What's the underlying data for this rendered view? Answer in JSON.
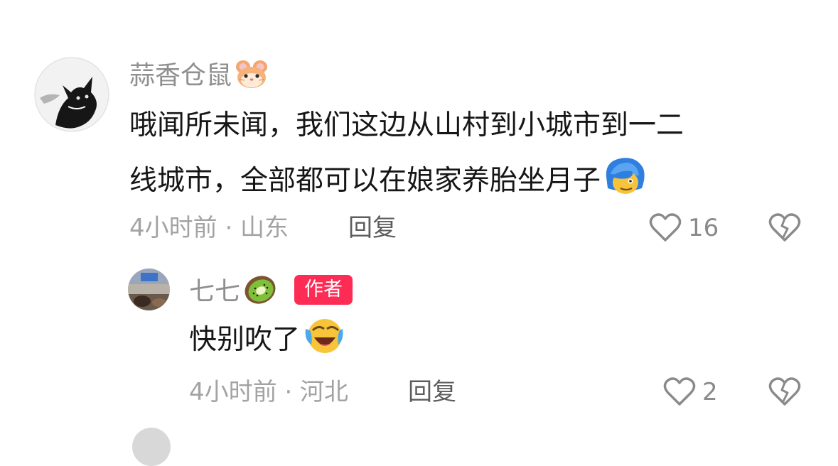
{
  "comments": [
    {
      "username": "蒜香仓鼠",
      "username_emoji": "hamster-face-icon",
      "text_lines": [
        "哦闻所未闻，我们这边从山村到小城市到一二",
        "线城市，全部都可以在娘家养胎坐月子"
      ],
      "text_emoji": "blue-hair-face-icon",
      "meta": "4小时前 · 山东",
      "reply_label": "回复",
      "like_count": "16"
    },
    {
      "username": "七七",
      "username_emoji": "kiwi-icon",
      "badge": "作者",
      "text": "快别吹了",
      "text_emoji": "laughing-crying-face-icon",
      "meta": "4小时前 · 河北",
      "reply_label": "回复",
      "like_count": "2"
    }
  ],
  "colors": {
    "badge_bg": "#fe2c55",
    "username": "#8f8f8f",
    "text": "#161616",
    "meta": "#a3a3a3"
  }
}
